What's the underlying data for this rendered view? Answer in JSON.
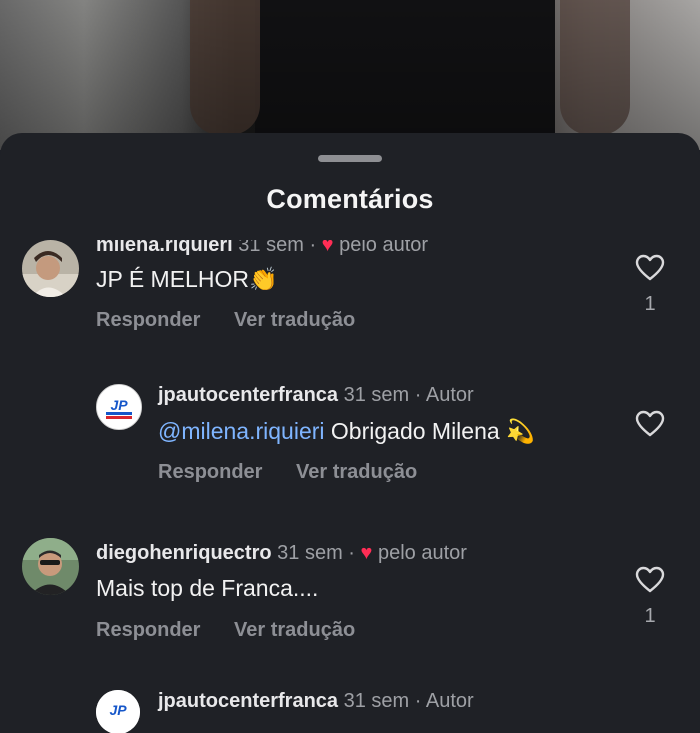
{
  "sheet": {
    "title": "Comentários"
  },
  "comments": [
    {
      "username": "milena.riquieri",
      "time": "31 sem",
      "separator": "·",
      "liked_by_author": "pelo autor",
      "text": "JP É MELHOR",
      "emoji": "👏",
      "reply_label": "Responder",
      "translate_label": "Ver tradução",
      "likes": "1"
    },
    {
      "username": "jpautocenterfranca",
      "time": "31 sem",
      "separator": "·",
      "author_tag": "Autor",
      "mention": "@milena.riquieri",
      "text": " Obrigado Milena ",
      "emoji": "💫",
      "reply_label": "Responder",
      "translate_label": "Ver tradução"
    },
    {
      "username": "diegohenriquectro",
      "time": "31 sem",
      "separator": "·",
      "liked_by_author": "pelo autor",
      "text": "Mais top de Franca....",
      "reply_label": "Responder",
      "translate_label": "Ver tradução",
      "likes": "1"
    },
    {
      "username": "jpautocenterfranca",
      "time": "31 sem",
      "separator": "·",
      "author_tag": "Autor"
    }
  ],
  "colors": {
    "sheet_bg": "#1f2126",
    "author_heart": "#ff2d55",
    "mention": "#7fb5ff",
    "muted_text": "#9ea0a5"
  }
}
